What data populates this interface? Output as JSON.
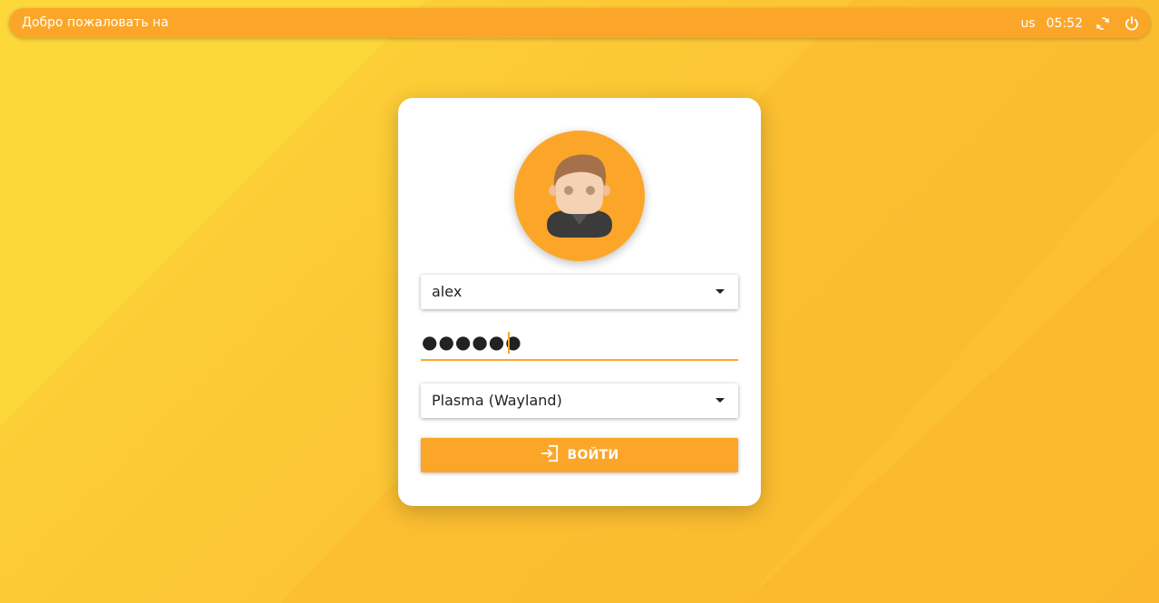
{
  "topbar": {
    "welcome_text": "Добро пожаловать на",
    "keyboard_layout": "us",
    "time": "05:52",
    "icons": {
      "reboot": "reboot-icon",
      "power": "power-icon"
    }
  },
  "login": {
    "user": "alex",
    "password_mask": "●●●●●●",
    "session": "Plasma (Wayland)",
    "login_label": "ВОЙТИ",
    "login_icon": "login-icon"
  },
  "colors": {
    "accent": "#fca629",
    "background": "#fcc634"
  }
}
